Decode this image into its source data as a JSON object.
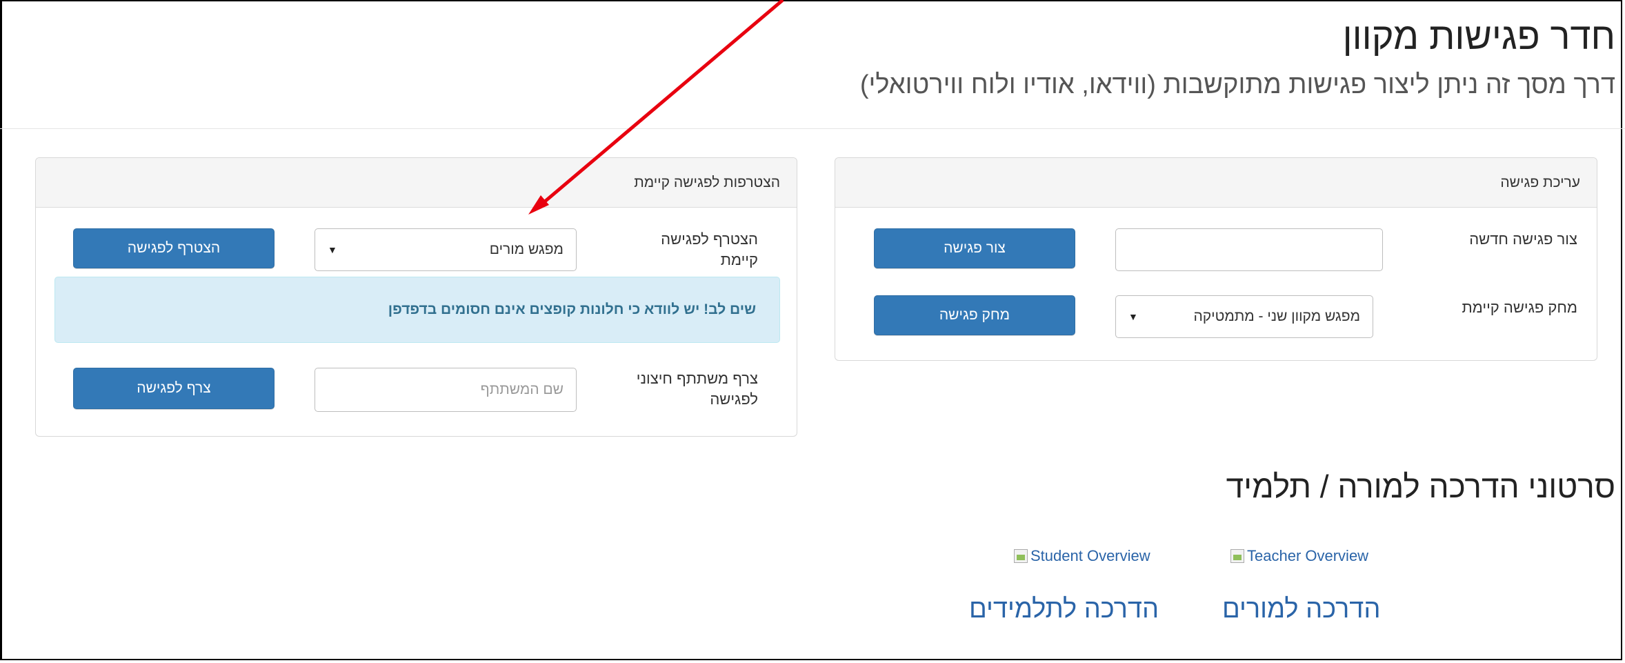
{
  "header": {
    "title": "חדר פגישות מקוון",
    "subtitle": "דרך מסך זה ניתן ליצור פגישות מתוקשבות (ווידאו, אודיו ולוח ווירטואלי)"
  },
  "edit_panel": {
    "title": "עריכת פגישה",
    "create_label": "צור פגישה חדשה",
    "create_input_value": "",
    "create_button": "צור פגישה",
    "delete_label": "מחק פגישה קיימת",
    "delete_select_value": "מפגש מקוון שני - מתמטיקה",
    "delete_button": "מחק פגישה"
  },
  "join_panel": {
    "title": "הצטרפות לפגישה קיימת",
    "join_label": "הצטרף לפגישה קיימת",
    "join_select_value": "מפגש מורים",
    "join_button": "הצטרף לפגישה",
    "alert": "שים לב! יש לוודא כי חלונות קופצים אינם חסומים בדפדפן",
    "external_label": "צרף משתתף חיצוני לפגישה",
    "external_placeholder": "שם המשתתף",
    "external_button": "צרף לפגישה"
  },
  "guides": {
    "title": "סרטוני הדרכה למורה / תלמיד",
    "teacher_overview": "Teacher Overview",
    "student_overview": "Student Overview",
    "teacher_link": "הדרכה למורים",
    "student_link": "הדרכה לתלמידים"
  },
  "annotation": {
    "arrow_color": "#e8000f"
  },
  "icons": {
    "select_caret": "▼",
    "broken_image": "broken-image-icon"
  }
}
